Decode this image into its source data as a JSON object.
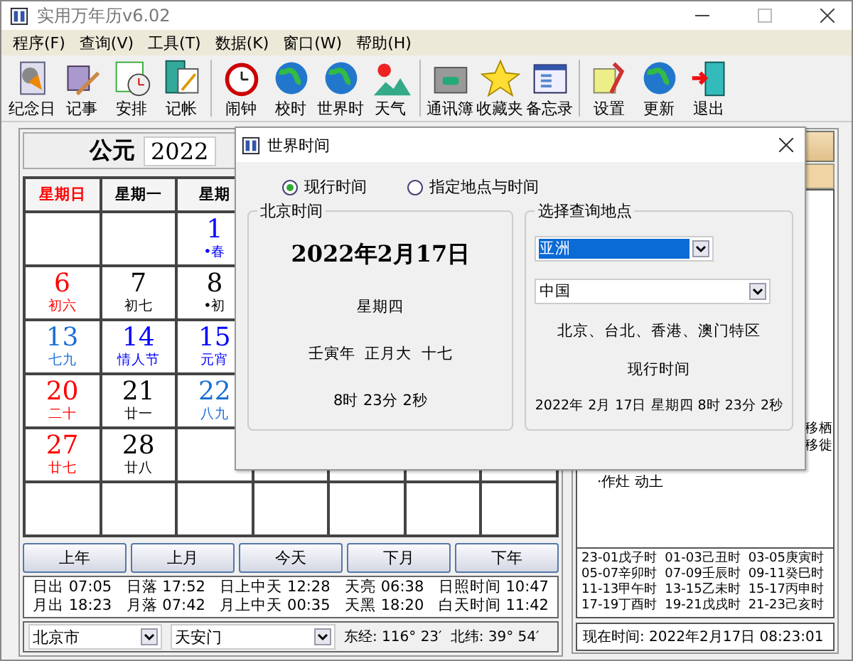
{
  "window": {
    "title": "实用万年历v6.02"
  },
  "menu": [
    "程序(F)",
    "查询(V)",
    "工具(T)",
    "数据(K)",
    "窗口(W)",
    "帮助(H)"
  ],
  "toolbar": [
    [
      "纪念日",
      "记事",
      "安排",
      "记帐"
    ],
    [
      "闹钟",
      "校时",
      "世界时",
      "天气"
    ],
    [
      "通讯簿",
      "收藏夹",
      "备忘录"
    ],
    [
      "设置",
      "更新",
      "退出"
    ]
  ],
  "calendar": {
    "era": "公元",
    "year": "2022",
    "weekdays": [
      {
        "label": "星期日",
        "color": "#ff0000"
      },
      {
        "label": "星期一",
        "color": "#000000"
      },
      {
        "label": "星期",
        "color": "#000000"
      }
    ],
    "weeks": [
      [
        {
          "day": "1",
          "note": "•春",
          "color": "#0000ff"
        }
      ],
      [
        {
          "day": "6",
          "note": "初六",
          "color": "#ff0000"
        },
        {
          "day": "7",
          "note": "初七",
          "color": "#000000"
        },
        {
          "day": "8",
          "note": "•初",
          "color": "#000000"
        }
      ],
      [
        {
          "day": "13",
          "note": "七九",
          "color": "#1a6fd6"
        },
        {
          "day": "14",
          "note": "情人节",
          "color": "#0000ff"
        },
        {
          "day": "15",
          "note": "元宵",
          "color": "#0000ff"
        }
      ],
      [
        {
          "day": "20",
          "note": "二十",
          "color": "#ff0000"
        },
        {
          "day": "21",
          "note": "廿一",
          "color": "#000000"
        },
        {
          "day": "22",
          "note": "八九",
          "color": "#1a6fd6"
        }
      ],
      [
        {
          "day": "27",
          "note": "廿七",
          "color": "#ff0000"
        },
        {
          "day": "28",
          "note": "廿八",
          "color": "#000000"
        }
      ]
    ]
  },
  "nav_buttons": [
    "上年",
    "上月",
    "今天",
    "下月",
    "下年"
  ],
  "sun_info": [
    [
      "日出 07:05",
      "日落 17:52",
      "日上中天 12:28",
      "天亮 06:38",
      "日照时间 10:47"
    ],
    [
      "月出 18:23",
      "月落 07:42",
      "月上中天 00:35",
      "天黑 18:20",
      "白天时间 11:42"
    ]
  ],
  "location": {
    "city": "北京市",
    "place": "天安门",
    "longitude": "东经: 116° 23′",
    "latitude": "北纬: 39° 54′"
  },
  "almanac": {
    "side_lines": [
      "移栖",
      "移徙"
    ],
    "bottom_line": "·作灶 动土"
  },
  "hours": [
    "23-01戊子时",
    "01-03己丑时",
    "03-05庚寅时",
    "05-07辛卯时",
    "07-09壬辰时",
    "09-11癸巳时",
    "11-13甲午时",
    "13-15乙未时",
    "15-17丙申时",
    "17-19丁酉时",
    "19-21戊戌时",
    "21-23己亥时"
  ],
  "now": "现在时间: 2022年2月17日 08:23:01",
  "dialog": {
    "title": "世界时间",
    "modes": [
      {
        "label": "现行时间",
        "selected": true
      },
      {
        "label": "指定地点与时间",
        "selected": false
      }
    ],
    "beijing": {
      "legend": "北京时间",
      "date": "2022年2月17日",
      "weekday": "星期四",
      "lunar": "壬寅年  正月大  十七",
      "time": "8时 23分 2秒"
    },
    "query": {
      "legend": "选择查询地点",
      "continent": {
        "value": "亚洲",
        "highlighted": true
      },
      "country": {
        "value": "中国",
        "highlighted": false
      },
      "zone": "北京、台北、香港、澳门特区",
      "mode": "现行时间",
      "result": "2022年 2月 17日 星期四 8时 23分 2秒"
    }
  }
}
